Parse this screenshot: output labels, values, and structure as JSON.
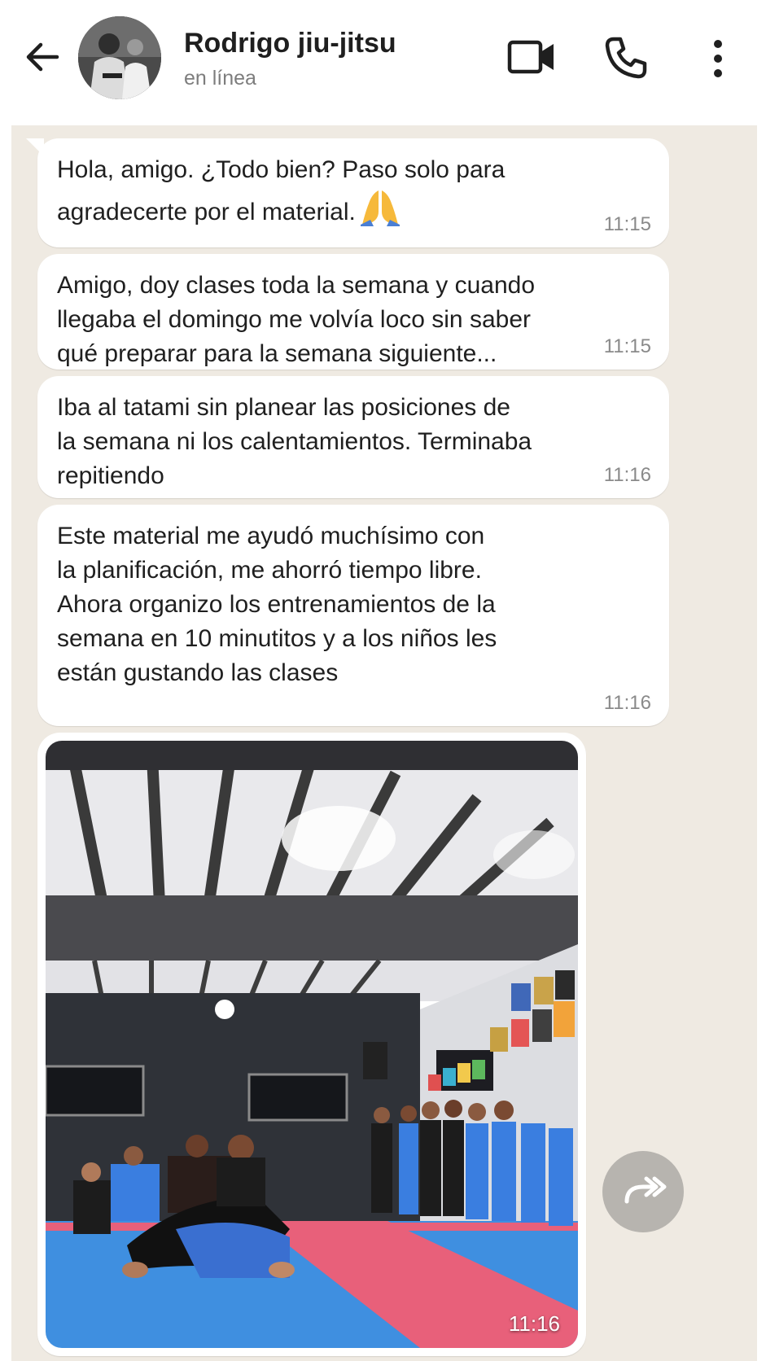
{
  "header": {
    "contact_name": "Rodrigo jiu-jitsu",
    "status": "en línea"
  },
  "messages": [
    {
      "text": "Hola, amigo. ¿Todo bien? Paso solo para\nagradecerte por el material.",
      "emoji": "folded-hands",
      "time": "11:15"
    },
    {
      "text": "Amigo, doy clases toda la semana y cuando\nllegaba el domingo me volvía loco sin saber\nqué preparar para la semana siguiente...",
      "time": "11:15"
    },
    {
      "text": "Iba al tatami sin planear las posiciones de\nla semana ni los calentamientos. Terminaba\nrepitiendo",
      "time": "11:16"
    },
    {
      "text": "Este material me ayudó muchísimo con\nla planificación, me ahorró tiempo libre.\nAhora organizo los entrenamientos de la\nsemana en 10 minutitos y a los niños les\nestán gustando las clases",
      "time": "11:16"
    }
  ],
  "image_message": {
    "time": "11:16"
  },
  "colors": {
    "chat_background": "#efeae2",
    "bubble": "#ffffff",
    "mat_blue": "#3f8fe0",
    "mat_pink": "#e8607a",
    "forward_button": "#b7b4af"
  },
  "icons": [
    "back-arrow-icon",
    "video-call-icon",
    "phone-icon",
    "more-vert-icon",
    "forward-icon",
    "folded-hands-emoji"
  ]
}
